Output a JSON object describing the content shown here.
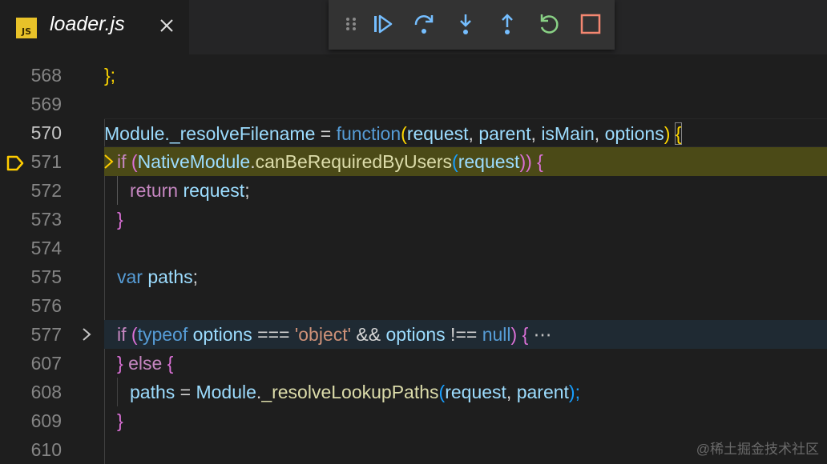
{
  "tab": {
    "file_name": "loader.js",
    "badge": "JS"
  },
  "debug_toolbar": {
    "icons": [
      "drag-handle-icon",
      "continue-icon",
      "step-over-icon",
      "step-into-icon",
      "step-out-icon",
      "restart-icon",
      "stop-icon"
    ],
    "colors": {
      "continue": "#75beff",
      "restart": "#89d185",
      "stop": "#f48771"
    }
  },
  "gutter": {
    "line_numbers": [
      "568",
      "569",
      "570",
      "571",
      "572",
      "573",
      "574",
      "575",
      "576",
      "577",
      "607",
      "608",
      "609",
      "610"
    ],
    "active_line": "570",
    "paused_line": "571",
    "folded_line": "577"
  },
  "code": {
    "l568": {
      "t1": "};"
    },
    "l570": {
      "t1": "Module._resolveFilename",
      "t2": " = ",
      "t3": "function",
      "t4": "(",
      "t5": "request",
      "t6": ", ",
      "t7": "parent",
      "t8": ", ",
      "t9": "isMain",
      "t10": ", ",
      "t11": "options",
      "t12": ") ",
      "t13": "{"
    },
    "l571": {
      "t1": "if",
      "t2": " (",
      "t3": "NativeModule",
      "t4": ".",
      "t5": "canBeRequiredByUsers",
      "t6": "(",
      "t7": "request",
      "t8": "))",
      "t9": " {"
    },
    "l572": {
      "t1": "return",
      "t2": " ",
      "t3": "request",
      "t4": ";"
    },
    "l573": {
      "t1": "}"
    },
    "l575": {
      "t1": "var",
      "t2": " ",
      "t3": "paths",
      "t4": ";"
    },
    "l577": {
      "t1": "if",
      "t2": " (",
      "t3": "typeof",
      "t4": " ",
      "t5": "options",
      "t6": " === ",
      "t7": "'object'",
      "t8": " && ",
      "t9": "options",
      "t10": " !== ",
      "t11": "null",
      "t12": ") ",
      "t13": "{",
      "t14": " ⋯"
    },
    "l607": {
      "t1": "}",
      "t2": " ",
      "t3": "else",
      "t4": " ",
      "t5": "{"
    },
    "l608": {
      "t1": "paths",
      "t2": " = ",
      "t3": "Module",
      "t4": ".",
      "t5": "_resolveLookupPaths",
      "t6": "(",
      "t7": "request",
      "t8": ", ",
      "t9": "parent",
      "t10": ");"
    },
    "l609": {
      "t1": "}"
    }
  },
  "watermark": "@稀土掘金技术社区"
}
